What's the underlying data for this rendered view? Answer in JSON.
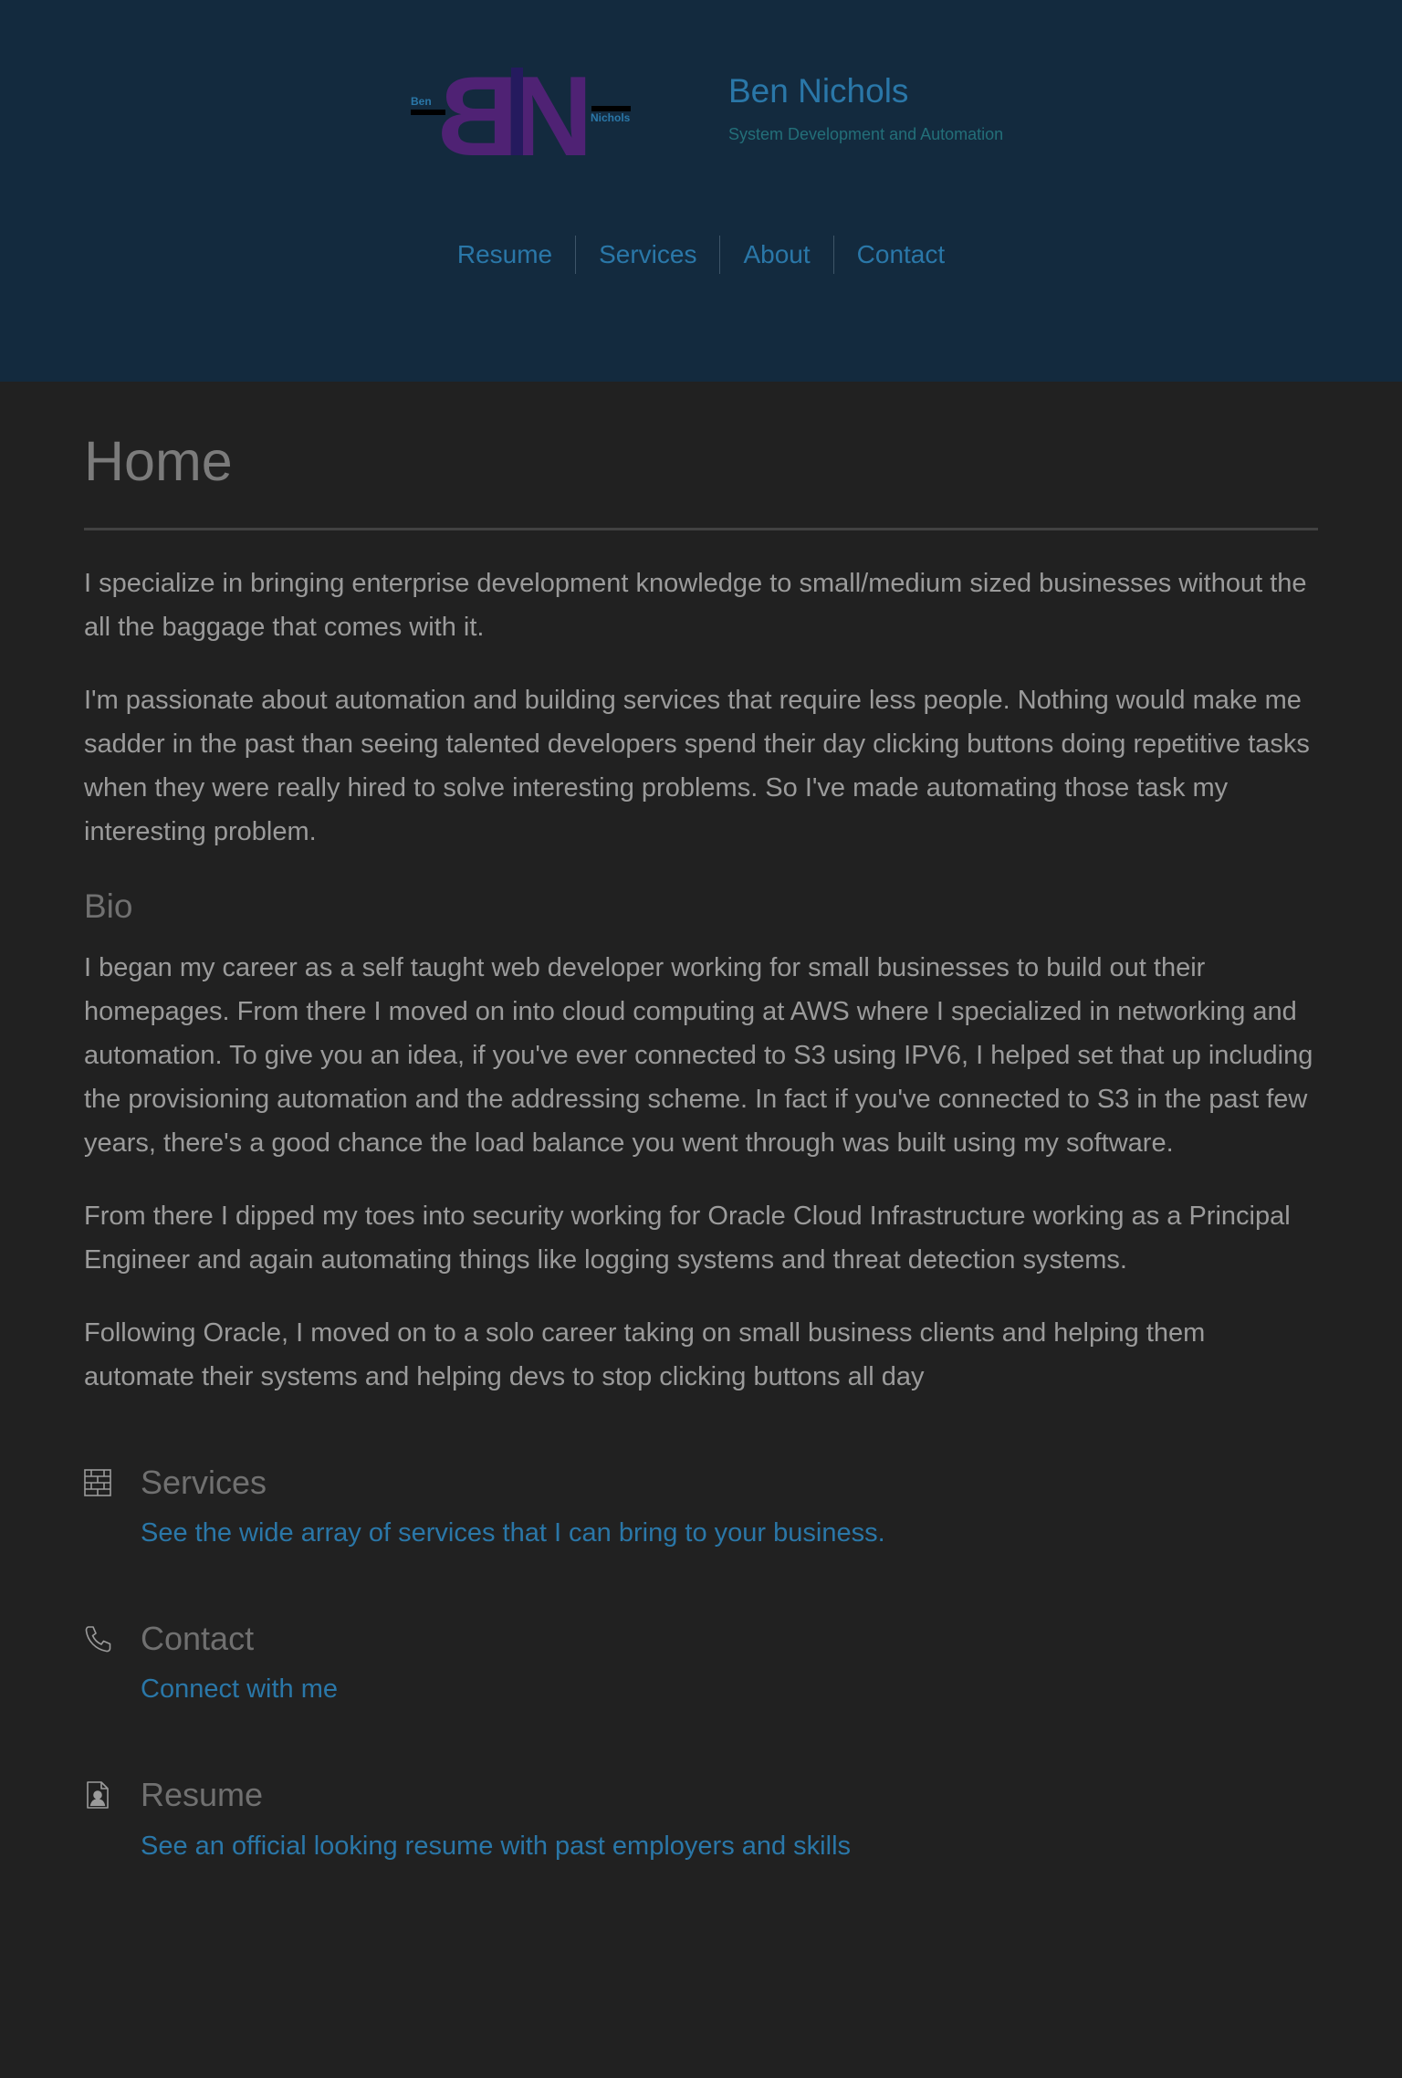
{
  "colors": {
    "header_bg": "#132a3e",
    "page_bg": "#212121",
    "link": "#2a77a8",
    "logo_purple": "#4f2274"
  },
  "logo": {
    "letters": "BN",
    "small_left": "Ben",
    "small_right": "Nichols"
  },
  "site": {
    "name": "Ben Nichols",
    "tagline": "System Development and Automation"
  },
  "nav": {
    "items": [
      {
        "label": "Resume"
      },
      {
        "label": "Services"
      },
      {
        "label": "About"
      },
      {
        "label": "Contact"
      }
    ]
  },
  "main": {
    "title": "Home",
    "intro": [
      "I specialize in bringing enterprise development knowledge to small/medium sized businesses without the all the baggage that comes with it.",
      "I'm passionate about automation and building services that require less people. Nothing would make me sadder in the past than seeing talented developers spend their day clicking buttons doing repetitive tasks when they were really hired to solve interesting problems. So I've made automating those task my interesting problem."
    ],
    "bio_title": "Bio",
    "bio": [
      "I began my career as a self taught web developer working for small businesses to build out their homepages. From there I moved on into cloud computing at AWS where I specialized in networking and automation. To give you an idea, if you've ever connected to S3 using IPV6, I helped set that up including the provisioning automation and the addressing scheme. In fact if you've connected to S3 in the past few years, there's a good chance the load balance you went through was built using my software.",
      "From there I dipped my toes into security working for Oracle Cloud Infrastructure working as a Principal Engineer and again automating things like logging systems and threat detection systems.",
      "Following Oracle, I moved on to a solo career taking on small business clients and helping them automate their systems and helping devs to stop clicking buttons all day"
    ]
  },
  "features": [
    {
      "icon": "brick-wall-icon",
      "title": "Services",
      "link": "See the wide array of services that I can bring to your business."
    },
    {
      "icon": "phone-icon",
      "title": "Contact",
      "link": "Connect with me"
    },
    {
      "icon": "resume-document-icon",
      "title": "Resume",
      "link": "See an official looking resume with past employers and skills"
    }
  ]
}
